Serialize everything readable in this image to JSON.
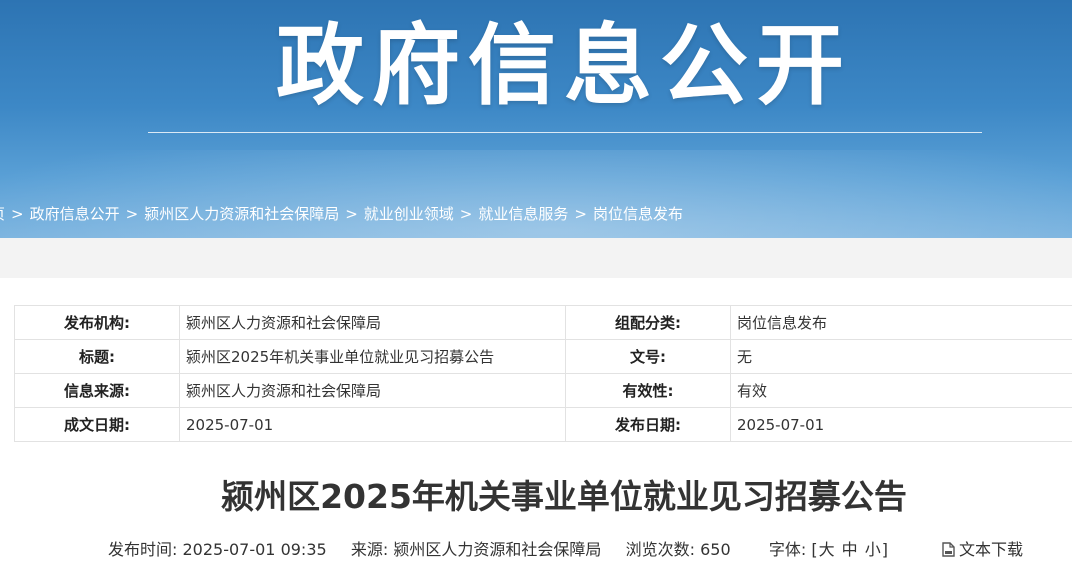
{
  "banner": {
    "title": "政府信息公开"
  },
  "breadcrumb": {
    "items": [
      "页",
      "政府信息公开",
      "颍州区人力资源和社会保障局",
      "就业创业领域",
      "就业信息服务",
      "岗位信息发布"
    ],
    "separator": ">"
  },
  "info_table": {
    "rows": [
      [
        {
          "label": "发布机构:",
          "value": "颍州区人力资源和社会保障局"
        },
        {
          "label": "组配分类:",
          "value": "岗位信息发布"
        }
      ],
      [
        {
          "label": "标题:",
          "value": "颍州区2025年机关事业单位就业见习招募公告"
        },
        {
          "label": "文号:",
          "value": "无"
        }
      ],
      [
        {
          "label": "信息来源:",
          "value": "颍州区人力资源和社会保障局"
        },
        {
          "label": "有效性:",
          "value": "有效"
        }
      ],
      [
        {
          "label": "成文日期:",
          "value": "2025-07-01"
        },
        {
          "label": "发布日期:",
          "value": "2025-07-01"
        }
      ]
    ]
  },
  "article": {
    "title": "颍州区2025年机关事业单位就业见习招募公告",
    "publish_time_label": "发布时间:",
    "publish_time": "2025-07-01 09:35",
    "source_label": "来源:",
    "source": "颍州区人力资源和社会保障局",
    "views_label": "浏览次数:",
    "views": "650",
    "font_label": "字体:",
    "font_open": "[",
    "font_large": "大",
    "font_medium": "中",
    "font_small": "小",
    "font_close": "]",
    "download_label": "文本下载",
    "download_icon": "document-icon"
  }
}
